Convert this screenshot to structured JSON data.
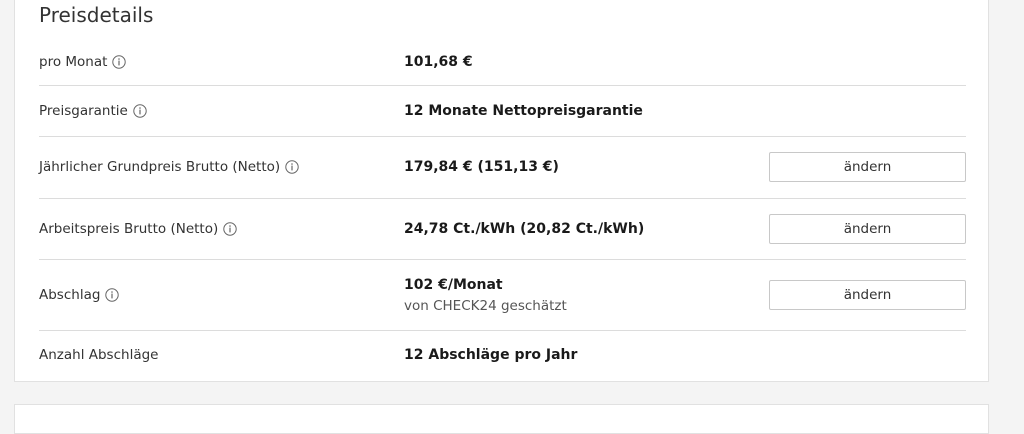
{
  "section": {
    "title": "Preisdetails"
  },
  "rows": [
    {
      "label": "pro Monat",
      "value": "101,68 €"
    },
    {
      "label": "Preisgarantie",
      "value": "12 Monate Nettopreisgarantie"
    },
    {
      "label": "Jährlicher Grundpreis Brutto (Netto)",
      "value": "179,84 € (151,13 €)",
      "button": "ändern"
    },
    {
      "label": "Arbeitspreis Brutto (Netto)",
      "value": "24,78 Ct./kWh (20,82 Ct./kWh)",
      "button": "ändern"
    },
    {
      "label": "Abschlag",
      "value": "102 €/Monat",
      "subvalue": "von CHECK24 geschätzt",
      "button": "ändern"
    },
    {
      "label": "Anzahl Abschläge",
      "value": "12 Abschläge pro Jahr"
    }
  ],
  "icons": {
    "info": "info-circle-icon"
  },
  "colors": {
    "text": "#333333",
    "border": "#dcdcdc",
    "background": "#f4f4f4"
  }
}
